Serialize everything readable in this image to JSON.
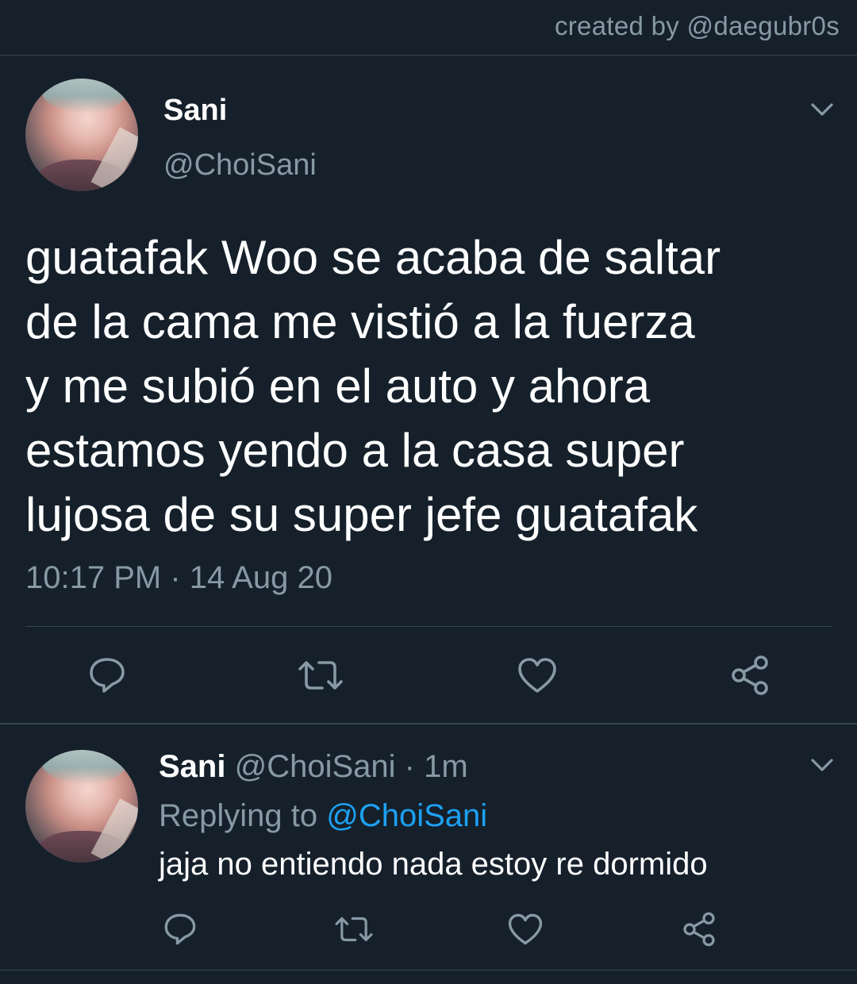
{
  "credit": "created by @daegubr0s",
  "main_tweet": {
    "display_name": "Sani",
    "handle": "@ChoiSani",
    "text": "guatafak Woo se acaba de saltar\nde la cama me vistió a la fuerza\ny me subió en el auto y ahora\nestamos yendo a la casa super\nlujosa de su super jefe guatafak",
    "timestamp": "10:17 PM · 14 Aug 20",
    "actions": [
      "reply-icon",
      "retweet-icon",
      "like-icon",
      "share-icon"
    ]
  },
  "reply_tweet": {
    "display_name": "Sani",
    "handle": "@ChoiSani",
    "separator": "·",
    "time": "1m",
    "replying_prefix": "Replying to",
    "replying_handle": "@ChoiSani",
    "text": "jaja no entiendo nada estoy re dormido",
    "actions": [
      "reply-icon",
      "retweet-icon",
      "like-icon",
      "share-icon"
    ]
  },
  "colors": {
    "background": "#15202b",
    "secondary_text": "#8899a6",
    "link": "#1da1f2",
    "divider": "#38444d"
  }
}
